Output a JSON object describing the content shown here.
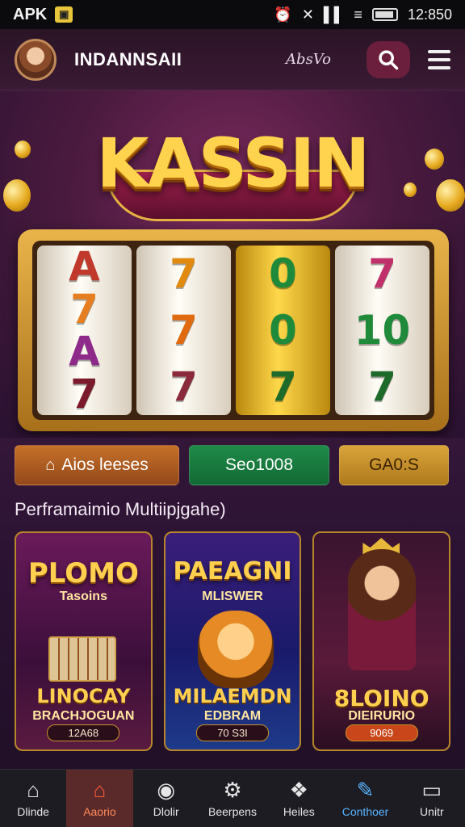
{
  "status_bar": {
    "left_label": "APK",
    "time": "12:850"
  },
  "header": {
    "brand": "INDANNSAII",
    "mini_logo": "AbsVo"
  },
  "hero": {
    "title": "KASSIN",
    "reels": [
      [
        "A",
        "7",
        "A",
        "7"
      ],
      [
        "7",
        "7",
        "7"
      ],
      [
        "0",
        "0",
        "7"
      ],
      [
        "7",
        "10",
        "7"
      ]
    ]
  },
  "actions": [
    {
      "label": "Aios leeses",
      "icon": "house-icon"
    },
    {
      "label": "Seo1008"
    },
    {
      "label": "GA0:S"
    }
  ],
  "section": {
    "title": "Perframaimio Multiipjgahe)"
  },
  "cards": [
    {
      "title": "PLOMO",
      "sub": "Tasoins",
      "bottom": "LINOCAY",
      "bottom2": "BRACHJOGUAN",
      "pill": "12A68"
    },
    {
      "title": "PAEAGNI",
      "sub": "MLISWER",
      "bottom": "MILAEMDN",
      "bottom2": "EDBRAM",
      "pill": "70 S3I"
    },
    {
      "title": "",
      "sub": "",
      "bottom": "8LOINO",
      "bottom2": "DIEIRURIO",
      "pill": "9069"
    }
  ],
  "nav": [
    {
      "label": "Dlinde",
      "icon": "home-icon"
    },
    {
      "label": "Aaorio",
      "icon": "house-icon"
    },
    {
      "label": "Dlolir",
      "icon": "circle-icon"
    },
    {
      "label": "Beerpens",
      "icon": "gear-icon"
    },
    {
      "label": "Heiles",
      "icon": "wing-icon"
    },
    {
      "label": "Conthoer",
      "icon": "edit-icon"
    },
    {
      "label": "Unitr",
      "icon": "card-icon"
    }
  ]
}
